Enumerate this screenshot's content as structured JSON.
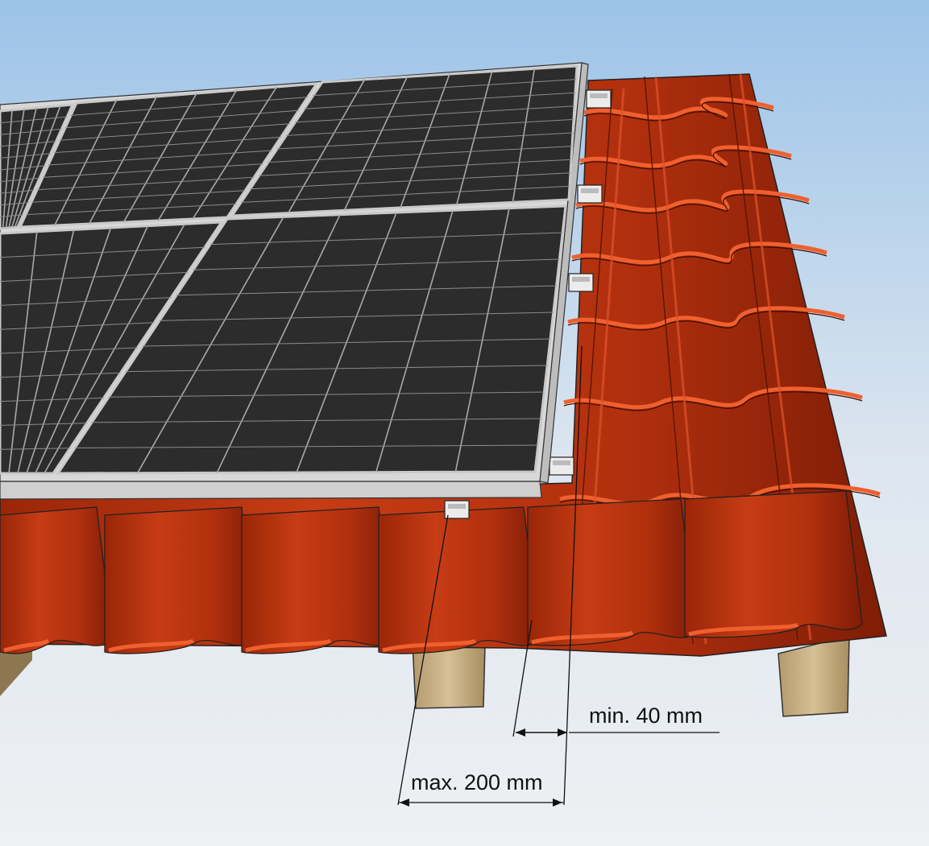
{
  "labels": {
    "min_overhang": "min. 40 mm",
    "max_overhang": "max. 200 mm"
  },
  "colors": {
    "sky_top": "#9cc3e8",
    "sky_bottom": "#eef0f3",
    "tile_face": "#c23a12",
    "tile_dark": "#7e1d06",
    "tile_light": "#e2532a",
    "panel_cell": "#2e2e2e",
    "panel_grid": "#a9a9a9",
    "panel_frame": "#d9d9d9",
    "batten": "#d2bb8e",
    "rail": "#e6e6e6"
  }
}
